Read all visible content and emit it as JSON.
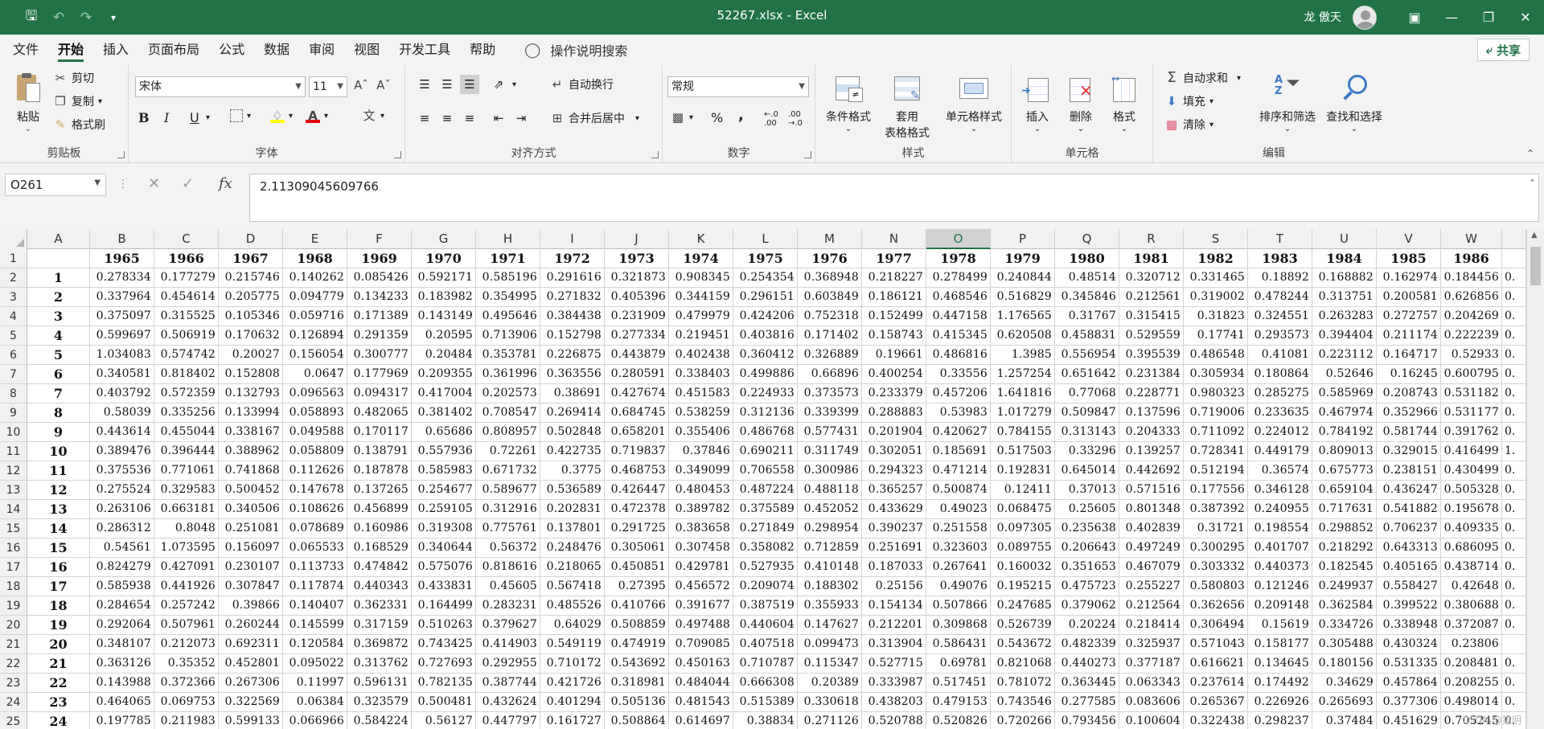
{
  "window": {
    "title": "52267.xlsx  -  Excel",
    "user": "龙 傲天"
  },
  "tabs": [
    "文件",
    "开始",
    "插入",
    "页面布局",
    "公式",
    "数据",
    "审阅",
    "视图",
    "开发工具",
    "帮助"
  ],
  "active_tab": "开始",
  "tell_me": "操作说明搜索",
  "share_label": "共享",
  "ribbon": {
    "clipboard": {
      "label": "剪贴板",
      "paste": "粘贴",
      "cut": "剪切",
      "copy": "复制",
      "format_painter": "格式刷"
    },
    "font": {
      "label": "字体",
      "font_name": "宋体",
      "font_size": "11",
      "bold": "B",
      "italic": "I",
      "underline": "U",
      "wen": "文"
    },
    "alignment": {
      "label": "对齐方式",
      "wrap": "自动换行",
      "merge": "合并后居中"
    },
    "number": {
      "label": "数字",
      "format": "常规",
      "percent": "%",
      "comma": ","
    },
    "styles": {
      "label": "样式",
      "conditional": "条件格式",
      "table_line1": "套用",
      "table_line2": "表格格式",
      "cell_styles": "单元格样式"
    },
    "cells": {
      "label": "单元格",
      "insert": "插入",
      "delete": "删除",
      "format": "格式"
    },
    "editing": {
      "label": "编辑",
      "autosum": "自动求和",
      "fill": "填充",
      "clear": "清除",
      "sort": "排序和筛选",
      "find": "查找和选择"
    }
  },
  "formula_bar": {
    "name_box": "O261",
    "fx": "fx",
    "formula": "2.11309045609766"
  },
  "columns": [
    "A",
    "B",
    "C",
    "D",
    "E",
    "F",
    "G",
    "H",
    "I",
    "J",
    "K",
    "L",
    "M",
    "N",
    "O",
    "P",
    "Q",
    "R",
    "S",
    "T",
    "U",
    "V",
    "W"
  ],
  "selected_column": "O",
  "years": [
    "1965",
    "1966",
    "1967",
    "1968",
    "1969",
    "1970",
    "1971",
    "1972",
    "1973",
    "1974",
    "1975",
    "1976",
    "1977",
    "1978",
    "1979",
    "1980",
    "1981",
    "1982",
    "1983",
    "1984",
    "1985",
    "1986"
  ],
  "rows": [
    {
      "n": "1",
      "v": [
        "0.278334",
        "0.177279",
        "0.215746",
        "0.140262",
        "0.085426",
        "0.592171",
        "0.585196",
        "0.291616",
        "0.321873",
        "0.908345",
        "0.254354",
        "0.368948",
        "0.218227",
        "0.278499",
        "0.240844",
        "0.48514",
        "0.320712",
        "0.331465",
        "0.18892",
        "0.168882",
        "0.162974",
        "0.184456"
      ],
      "x": "0."
    },
    {
      "n": "2",
      "v": [
        "0.337964",
        "0.454614",
        "0.205775",
        "0.094779",
        "0.134233",
        "0.183982",
        "0.354995",
        "0.271832",
        "0.405396",
        "0.344159",
        "0.296151",
        "0.603849",
        "0.186121",
        "0.468546",
        "0.516829",
        "0.345846",
        "0.212561",
        "0.319002",
        "0.478244",
        "0.313751",
        "0.200581",
        "0.626856"
      ],
      "x": "0."
    },
    {
      "n": "3",
      "v": [
        "0.375097",
        "0.315525",
        "0.105346",
        "0.059716",
        "0.171389",
        "0.143149",
        "0.495646",
        "0.384438",
        "0.231909",
        "0.479979",
        "0.424206",
        "0.752318",
        "0.152499",
        "0.447158",
        "1.176565",
        "0.31767",
        "0.315415",
        "0.31823",
        "0.324551",
        "0.263283",
        "0.272757",
        "0.204269"
      ],
      "x": "0."
    },
    {
      "n": "4",
      "v": [
        "0.599697",
        "0.506919",
        "0.170632",
        "0.126894",
        "0.291359",
        "0.20595",
        "0.713906",
        "0.152798",
        "0.277334",
        "0.219451",
        "0.403816",
        "0.171402",
        "0.158743",
        "0.415345",
        "0.620508",
        "0.458831",
        "0.529559",
        "0.17741",
        "0.293573",
        "0.394404",
        "0.211174",
        "0.222239"
      ],
      "x": "0."
    },
    {
      "n": "5",
      "v": [
        "1.034083",
        "0.574742",
        "0.20027",
        "0.156054",
        "0.300777",
        "0.20484",
        "0.353781",
        "0.226875",
        "0.443879",
        "0.402438",
        "0.360412",
        "0.326889",
        "0.19661",
        "0.486816",
        "1.3985",
        "0.556954",
        "0.395539",
        "0.486548",
        "0.41081",
        "0.223112",
        "0.164717",
        "0.52933"
      ],
      "x": "0."
    },
    {
      "n": "6",
      "v": [
        "0.340581",
        "0.818402",
        "0.152808",
        "0.0647",
        "0.177969",
        "0.209355",
        "0.361996",
        "0.363556",
        "0.280591",
        "0.338403",
        "0.499886",
        "0.66896",
        "0.400254",
        "0.33556",
        "1.257254",
        "0.651642",
        "0.231384",
        "0.305934",
        "0.180864",
        "0.52646",
        "0.16245",
        "0.600795"
      ],
      "x": "0."
    },
    {
      "n": "7",
      "v": [
        "0.403792",
        "0.572359",
        "0.132793",
        "0.096563",
        "0.094317",
        "0.417004",
        "0.202573",
        "0.38691",
        "0.427674",
        "0.451583",
        "0.224933",
        "0.373573",
        "0.233379",
        "0.457206",
        "1.641816",
        "0.77068",
        "0.228771",
        "0.980323",
        "0.285275",
        "0.585969",
        "0.208743",
        "0.531182"
      ],
      "x": "0."
    },
    {
      "n": "8",
      "v": [
        "0.58039",
        "0.335256",
        "0.133994",
        "0.058893",
        "0.482065",
        "0.381402",
        "0.708547",
        "0.269414",
        "0.684745",
        "0.538259",
        "0.312136",
        "0.339399",
        "0.288883",
        "0.53983",
        "1.017279",
        "0.509847",
        "0.137596",
        "0.719006",
        "0.233635",
        "0.467974",
        "0.352966",
        "0.531177"
      ],
      "x": "0."
    },
    {
      "n": "9",
      "v": [
        "0.443614",
        "0.455044",
        "0.338167",
        "0.049588",
        "0.170117",
        "0.65686",
        "0.808957",
        "0.502848",
        "0.658201",
        "0.355406",
        "0.486768",
        "0.577431",
        "0.201904",
        "0.420627",
        "0.784155",
        "0.313143",
        "0.204333",
        "0.711092",
        "0.224012",
        "0.784192",
        "0.581744",
        "0.391762"
      ],
      "x": "0."
    },
    {
      "n": "10",
      "v": [
        "0.389476",
        "0.396444",
        "0.388962",
        "0.058809",
        "0.138791",
        "0.557936",
        "0.72261",
        "0.422735",
        "0.719837",
        "0.37846",
        "0.690211",
        "0.311749",
        "0.302051",
        "0.185691",
        "0.517503",
        "0.33296",
        "0.139257",
        "0.728341",
        "0.449179",
        "0.809013",
        "0.329015",
        "0.416499"
      ],
      "x": "1."
    },
    {
      "n": "11",
      "v": [
        "0.375536",
        "0.771061",
        "0.741868",
        "0.112626",
        "0.187878",
        "0.585983",
        "0.671732",
        "0.3775",
        "0.468753",
        "0.349099",
        "0.706558",
        "0.300986",
        "0.294323",
        "0.471214",
        "0.192831",
        "0.645014",
        "0.442692",
        "0.512194",
        "0.36574",
        "0.675773",
        "0.238151",
        "0.430499"
      ],
      "x": "0."
    },
    {
      "n": "12",
      "v": [
        "0.275524",
        "0.329583",
        "0.500452",
        "0.147678",
        "0.137265",
        "0.254677",
        "0.589677",
        "0.536589",
        "0.426447",
        "0.480453",
        "0.487224",
        "0.488118",
        "0.365257",
        "0.500874",
        "0.12411",
        "0.37013",
        "0.571516",
        "0.177556",
        "0.346128",
        "0.659104",
        "0.436247",
        "0.505328"
      ],
      "x": "0."
    },
    {
      "n": "13",
      "v": [
        "0.263106",
        "0.663181",
        "0.340506",
        "0.108626",
        "0.456899",
        "0.259105",
        "0.312916",
        "0.202831",
        "0.472378",
        "0.389782",
        "0.375589",
        "0.452052",
        "0.433629",
        "0.49023",
        "0.068475",
        "0.25605",
        "0.801348",
        "0.387392",
        "0.240955",
        "0.717631",
        "0.541882",
        "0.195678"
      ],
      "x": "0."
    },
    {
      "n": "14",
      "v": [
        "0.286312",
        "0.8048",
        "0.251081",
        "0.078689",
        "0.160986",
        "0.319308",
        "0.775761",
        "0.137801",
        "0.291725",
        "0.383658",
        "0.271849",
        "0.298954",
        "0.390237",
        "0.251558",
        "0.097305",
        "0.235638",
        "0.402839",
        "0.31721",
        "0.198554",
        "0.298852",
        "0.706237",
        "0.409335"
      ],
      "x": "0."
    },
    {
      "n": "15",
      "v": [
        "0.54561",
        "1.073595",
        "0.156097",
        "0.065533",
        "0.168529",
        "0.340644",
        "0.56372",
        "0.248476",
        "0.305061",
        "0.307458",
        "0.358082",
        "0.712859",
        "0.251691",
        "0.323603",
        "0.089755",
        "0.206643",
        "0.497249",
        "0.300295",
        "0.401707",
        "0.218292",
        "0.643313",
        "0.686095"
      ],
      "x": "0."
    },
    {
      "n": "16",
      "v": [
        "0.824279",
        "0.427091",
        "0.230107",
        "0.113733",
        "0.474842",
        "0.575076",
        "0.818616",
        "0.218065",
        "0.450851",
        "0.429781",
        "0.527935",
        "0.410148",
        "0.187033",
        "0.267641",
        "0.160032",
        "0.351653",
        "0.467079",
        "0.303332",
        "0.440373",
        "0.182545",
        "0.405165",
        "0.438714"
      ],
      "x": "0."
    },
    {
      "n": "17",
      "v": [
        "0.585938",
        "0.441926",
        "0.307847",
        "0.117874",
        "0.440343",
        "0.433831",
        "0.45605",
        "0.567418",
        "0.27395",
        "0.456572",
        "0.209074",
        "0.188302",
        "0.25156",
        "0.49076",
        "0.195215",
        "0.475723",
        "0.255227",
        "0.580803",
        "0.121246",
        "0.249937",
        "0.558427",
        "0.42648"
      ],
      "x": "0."
    },
    {
      "n": "18",
      "v": [
        "0.284654",
        "0.257242",
        "0.39866",
        "0.140407",
        "0.362331",
        "0.164499",
        "0.283231",
        "0.485526",
        "0.410766",
        "0.391677",
        "0.387519",
        "0.355933",
        "0.154134",
        "0.507866",
        "0.247685",
        "0.379062",
        "0.212564",
        "0.362656",
        "0.209148",
        "0.362584",
        "0.399522",
        "0.380688"
      ],
      "x": "0."
    },
    {
      "n": "19",
      "v": [
        "0.292064",
        "0.507961",
        "0.260244",
        "0.145599",
        "0.317159",
        "0.510263",
        "0.379627",
        "0.64029",
        "0.508859",
        "0.497488",
        "0.440604",
        "0.147627",
        "0.212201",
        "0.309868",
        "0.526739",
        "0.20224",
        "0.218414",
        "0.306494",
        "0.15619",
        "0.334726",
        "0.338948",
        "0.372087"
      ],
      "x": "0."
    },
    {
      "n": "20",
      "v": [
        "0.348107",
        "0.212073",
        "0.692311",
        "0.120584",
        "0.369872",
        "0.743425",
        "0.414903",
        "0.549119",
        "0.474919",
        "0.709085",
        "0.407518",
        "0.099473",
        "0.313904",
        "0.586431",
        "0.543672",
        "0.482339",
        "0.325937",
        "0.571043",
        "0.158177",
        "0.305488",
        "0.430324",
        "0.23806"
      ],
      "x": ""
    },
    {
      "n": "21",
      "v": [
        "0.363126",
        "0.35352",
        "0.452801",
        "0.095022",
        "0.313762",
        "0.727693",
        "0.292955",
        "0.710172",
        "0.543692",
        "0.450163",
        "0.710787",
        "0.115347",
        "0.527715",
        "0.69781",
        "0.821068",
        "0.440273",
        "0.377187",
        "0.616621",
        "0.134645",
        "0.180156",
        "0.531335",
        "0.208481"
      ],
      "x": "0."
    },
    {
      "n": "22",
      "v": [
        "0.143988",
        "0.372366",
        "0.267306",
        "0.11997",
        "0.596131",
        "0.782135",
        "0.387744",
        "0.421726",
        "0.318981",
        "0.484044",
        "0.666308",
        "0.20389",
        "0.333987",
        "0.517451",
        "0.781072",
        "0.363445",
        "0.063343",
        "0.237614",
        "0.174492",
        "0.34629",
        "0.457864",
        "0.208255"
      ],
      "x": "0."
    },
    {
      "n": "23",
      "v": [
        "0.464065",
        "0.069753",
        "0.322569",
        "0.06384",
        "0.323579",
        "0.500481",
        "0.432624",
        "0.401294",
        "0.505136",
        "0.481543",
        "0.515389",
        "0.330618",
        "0.438203",
        "0.479153",
        "0.743546",
        "0.277585",
        "0.083606",
        "0.265367",
        "0.226926",
        "0.265693",
        "0.377306",
        "0.498014"
      ],
      "x": "0."
    },
    {
      "n": "24",
      "v": [
        "0.197785",
        "0.211983",
        "0.599133",
        "0.066966",
        "0.584224",
        "0.56127",
        "0.447797",
        "0.161727",
        "0.508864",
        "0.614697",
        "0.38834",
        "0.271126",
        "0.520788",
        "0.520826",
        "0.720266",
        "0.793456",
        "0.100604",
        "0.322438",
        "0.298237",
        "0.37484",
        "0.451629",
        "0.705245"
      ],
      "x": "0."
    }
  ],
  "watermark": "CSDN @猫明"
}
